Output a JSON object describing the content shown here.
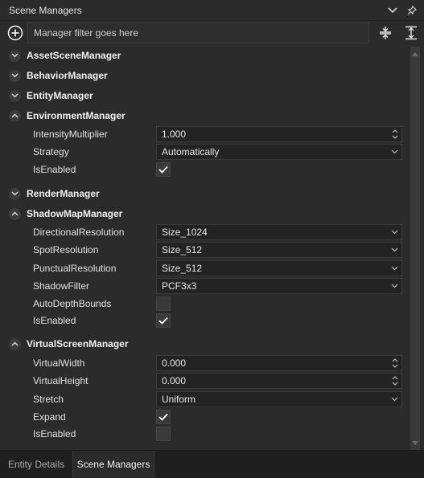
{
  "panel": {
    "title": "Scene Managers"
  },
  "toolbar": {
    "filter_placeholder": "Manager filter goes here"
  },
  "managers": {
    "asset": {
      "name": "AssetSceneManager"
    },
    "behavior": {
      "name": "BehaviorManager"
    },
    "entity": {
      "name": "EntityManager"
    },
    "environment": {
      "name": "EnvironmentManager",
      "intensity_label": "IntensityMultiplier",
      "intensity_value": "1.000",
      "strategy_label": "Strategy",
      "strategy_value": "Automatically",
      "enabled_label": "IsEnabled"
    },
    "render": {
      "name": "RenderManager"
    },
    "shadow": {
      "name": "ShadowMapManager",
      "directional_label": "DirectionalResolution",
      "directional_value": "Size_1024",
      "spot_label": "SpotResolution",
      "spot_value": "Size_512",
      "punctual_label": "PunctualResolution",
      "punctual_value": "Size_512",
      "filter_label": "ShadowFilter",
      "filter_value": "PCF3x3",
      "autodepth_label": "AutoDepthBounds",
      "enabled_label": "IsEnabled"
    },
    "virtual": {
      "name": "VirtualScreenManager",
      "width_label": "VirtualWidth",
      "width_value": "0.000",
      "height_label": "VirtualHeight",
      "height_value": "0.000",
      "stretch_label": "Stretch",
      "stretch_value": "Uniform",
      "expand_label": "Expand",
      "enabled_label": "IsEnabled"
    }
  },
  "tabs": {
    "entity_details": "Entity Details",
    "scene_managers": "Scene Managers"
  },
  "icons": {
    "title_chevron": "chevron-down-icon",
    "title_pin": "pin-icon",
    "add": "plus-circle-icon",
    "collapse_all": "collapse-all-icon",
    "expand_all": "expand-all-icon"
  },
  "colors": {
    "background": "#2b2b2b",
    "field": "#232323",
    "text": "#e6e6e6",
    "tabbar": "#1f1f1f"
  }
}
